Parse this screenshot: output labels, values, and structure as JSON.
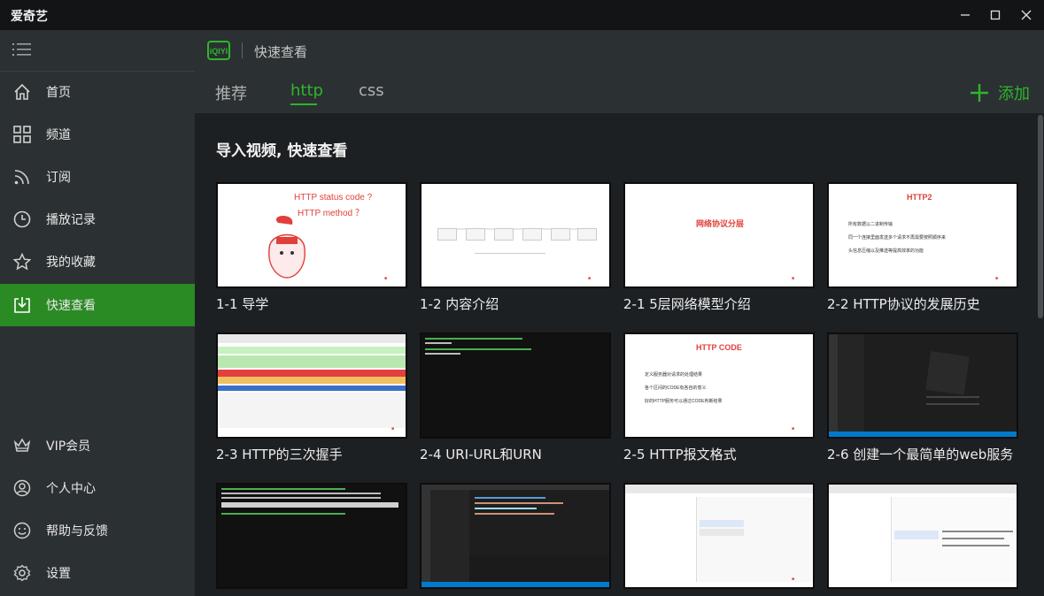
{
  "app": {
    "title": "爱奇艺"
  },
  "sidebar": {
    "items": [
      {
        "label": "首页",
        "icon": "home-icon"
      },
      {
        "label": "频道",
        "icon": "grid-icon"
      },
      {
        "label": "订阅",
        "icon": "rss-icon"
      },
      {
        "label": "播放记录",
        "icon": "clock-icon"
      },
      {
        "label": "我的收藏",
        "icon": "star-icon"
      },
      {
        "label": "快速查看",
        "icon": "download-icon",
        "active": true
      }
    ],
    "bottom_items": [
      {
        "label": "VIP会员",
        "icon": "crown-icon"
      },
      {
        "label": "个人中心",
        "icon": "user-icon"
      },
      {
        "label": "帮助与反馈",
        "icon": "smile-icon"
      },
      {
        "label": "设置",
        "icon": "gear-icon"
      }
    ]
  },
  "header": {
    "logo": "iQIYI",
    "breadcrumb": "快速查看"
  },
  "tabs": [
    {
      "label": "推荐"
    },
    {
      "label": "http",
      "active": true
    },
    {
      "label": "css"
    }
  ],
  "add_button": {
    "label": "添加"
  },
  "main": {
    "section_title": "导入视频, 快速查看",
    "videos": [
      {
        "title": "1-1 导学",
        "thumb_text": [
          "HTTP status code ?",
          "HTTP method ？"
        ]
      },
      {
        "title": "1-2 内容介绍"
      },
      {
        "title": "2-1 5层网络模型介绍",
        "thumb_text": [
          "网络协议分层"
        ]
      },
      {
        "title": "2-2 HTTP协议的发展历史",
        "thumb_text": [
          "HTTP2",
          "所有数据以二进制传输",
          "同一个连接里面发送多个请求不再需要按照顺序来",
          "头信息压缩以及推送等提高效率的功能"
        ]
      },
      {
        "title": "2-3 HTTP的三次握手"
      },
      {
        "title": "2-4 URI-URL和URN"
      },
      {
        "title": "2-5 HTTP报文格式",
        "thumb_text": [
          "HTTP CODE",
          "定义服务器对请求的处理结果",
          "各个区间的CODE有各自的意义",
          "好的HTTP服务可以通过CODE判断结果"
        ]
      },
      {
        "title": "2-6 创建一个最简单的web服务"
      },
      {
        "title": ""
      },
      {
        "title": ""
      },
      {
        "title": ""
      },
      {
        "title": ""
      }
    ]
  },
  "colors": {
    "accent": "#2fb52a",
    "sidebar_active": "#2a8a24",
    "sidebar_bg": "#2b3033",
    "content_bg": "#1d2023"
  }
}
